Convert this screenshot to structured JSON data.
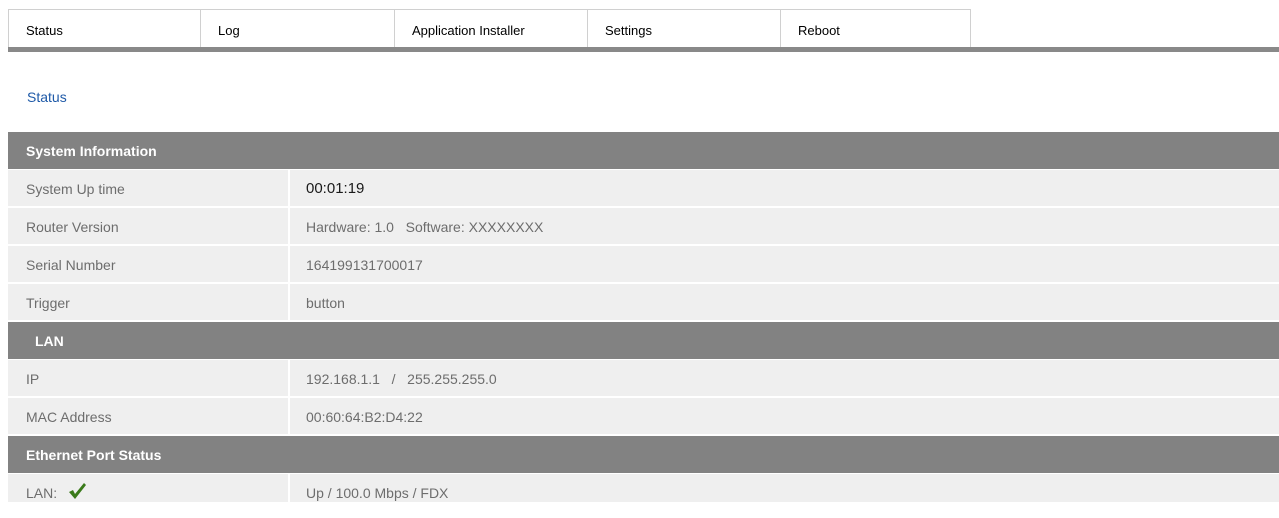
{
  "tabs": [
    {
      "label": "Status"
    },
    {
      "label": "Log"
    },
    {
      "label": "Application Installer"
    },
    {
      "label": "Settings"
    },
    {
      "label": "Reboot"
    }
  ],
  "breadcrumb": "Status",
  "sections": {
    "system_information": {
      "title": "System Information",
      "rows": [
        {
          "label": "System Up time",
          "value": "00:01:19"
        },
        {
          "label": "Router Version",
          "value": "Hardware: 1.0   Software: XXXXXXXX"
        },
        {
          "label": "Serial Number",
          "value": "164199131700017"
        },
        {
          "label": "Trigger",
          "value": "button"
        }
      ]
    },
    "lan": {
      "title": "LAN",
      "rows": [
        {
          "label": "IP",
          "value": "192.168.1.1   /   255.255.255.0"
        },
        {
          "label": "MAC Address",
          "value": "00:60:64:B2:D4:22"
        }
      ]
    },
    "ethernet_port_status": {
      "title": "Ethernet Port Status",
      "rows": [
        {
          "label": "LAN:",
          "value": "Up / 100.0 Mbps / FDX",
          "icon": "checkmark-icon",
          "icon_color": "#3a7a1a"
        }
      ]
    }
  },
  "colors": {
    "header_bg": "#828282",
    "row_bg": "#efefef",
    "link": "#1f5aa8",
    "tab_rule": "#898989"
  }
}
